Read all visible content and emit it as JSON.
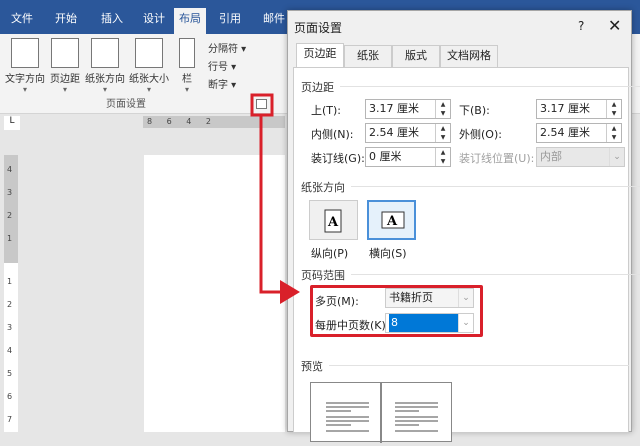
{
  "ribbon": {
    "tabs": [
      "文件",
      "开始",
      "插入",
      "设计",
      "布局",
      "引用",
      "邮件"
    ],
    "buttons": [
      "文字方向",
      "页边距",
      "纸张方向",
      "纸张大小",
      "栏"
    ],
    "small": [
      "分隔符 ▾",
      "行号 ▾",
      "断字 ▾"
    ],
    "group_label": "页面设置"
  },
  "ruler": {
    "h": "8 6 4 2",
    "v_gray": [
      "4",
      "3",
      "2",
      "1"
    ],
    "v_white": [
      "1",
      "2",
      "3",
      "4",
      "5",
      "6",
      "7"
    ],
    "corner": "L"
  },
  "dialog": {
    "title": "页面设置",
    "help": "?",
    "close": "✕",
    "tabs": [
      "页边距",
      "纸张",
      "版式",
      "文档网格"
    ],
    "margins_label": "页边距",
    "top_label": "上(T):",
    "top": "3.17 厘米",
    "bottom_label": "下(B):",
    "bottom": "3.17 厘米",
    "inside_label": "内侧(N):",
    "inside": "2.54 厘米",
    "outside_label": "外侧(O):",
    "outside": "2.54 厘米",
    "gutter_label": "装订线(G):",
    "gutter": "0 厘米",
    "gutter_pos_label": "装订线位置(U):",
    "gutter_pos": "内部",
    "orientation_label": "纸张方向",
    "portrait": "纵向(P)",
    "landscape": "横向(S)",
    "pages_label": "页码范围",
    "multiple_label": "多页(M):",
    "multiple": "书籍折页",
    "sheets_label": "每册中页数(K):",
    "sheets": "8",
    "preview_label": "预览"
  },
  "colors": {
    "accent": "#2b579a",
    "highlight": "#d9202a"
  }
}
